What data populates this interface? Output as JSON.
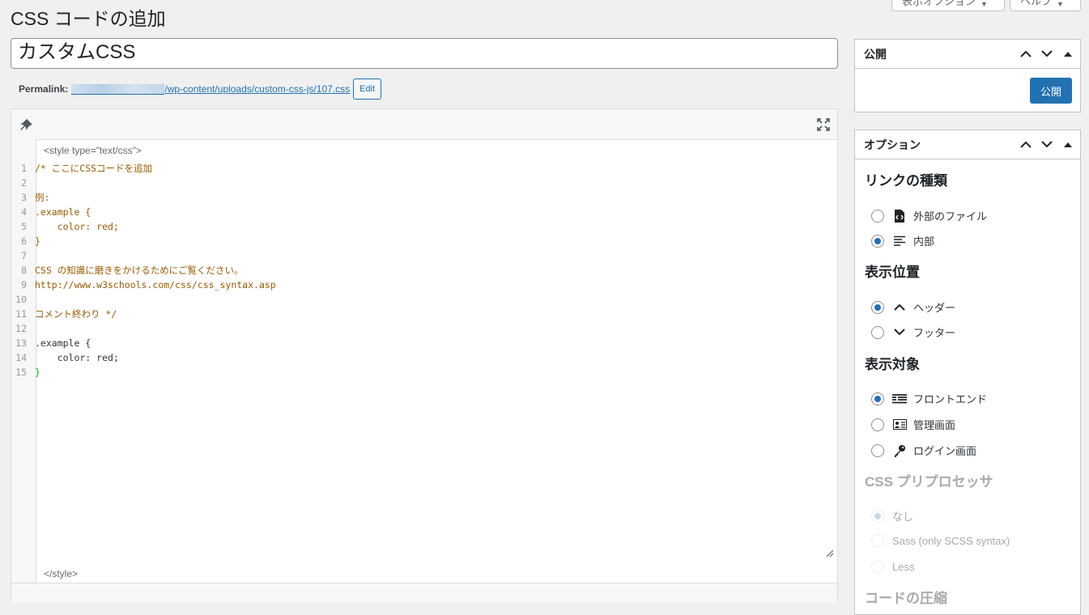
{
  "header": {
    "page_title": "CSS コードの追加",
    "screen_options": "表示オプション",
    "help": "ヘルプ"
  },
  "post": {
    "title": "カスタムCSS",
    "permalink_label": "Permalink:",
    "permalink_path": "/wp-content/uploads/custom-css-js/107.css",
    "edit_label": "Edit"
  },
  "editor": {
    "style_open": "<style type=\"text/css\">",
    "style_close": "</style>",
    "lines": [
      "/* ここにCSSコードを追加",
      "",
      "例:",
      ".example {",
      "    color: red;",
      "}",
      "",
      "CSS の知識に磨きをかけるためにご覧ください。",
      "http://www.w3schools.com/css/css_syntax.asp",
      "",
      "コメント終わり */",
      "",
      ".example {",
      "    color: red;",
      "}"
    ]
  },
  "publish_box": {
    "title": "公開",
    "publish_button": "公開"
  },
  "options_box": {
    "title": "オプション",
    "link_type": {
      "heading": "リンクの種類",
      "options": [
        {
          "label": "外部のファイル",
          "icon": "code-file-icon",
          "selected": false
        },
        {
          "label": "内部",
          "icon": "text-lines-icon",
          "selected": true
        }
      ]
    },
    "position": {
      "heading": "表示位置",
      "options": [
        {
          "label": "ヘッダー",
          "icon": "chevron-up-icon",
          "selected": true
        },
        {
          "label": "フッター",
          "icon": "chevron-down-icon",
          "selected": false
        }
      ]
    },
    "target": {
      "heading": "表示対象",
      "options": [
        {
          "label": "フロントエンド",
          "icon": "frontend-icon",
          "selected": true
        },
        {
          "label": "管理画面",
          "icon": "admin-card-icon",
          "selected": false
        },
        {
          "label": "ログイン画面",
          "icon": "key-icon",
          "selected": false
        }
      ]
    },
    "preprocessor": {
      "heading": "CSS プリプロセッサ",
      "options": [
        {
          "label": "なし",
          "selected": true
        },
        {
          "label": "Sass (only SCSS syntax)",
          "selected": false
        },
        {
          "label": "Less",
          "selected": false
        }
      ]
    },
    "minify_heading": "コードの圧縮"
  },
  "colors": {
    "primary": "#2271b1",
    "background": "#f0f0f1",
    "comment": "#a0522d",
    "bracket": "#22aa22",
    "value": "#221199"
  }
}
